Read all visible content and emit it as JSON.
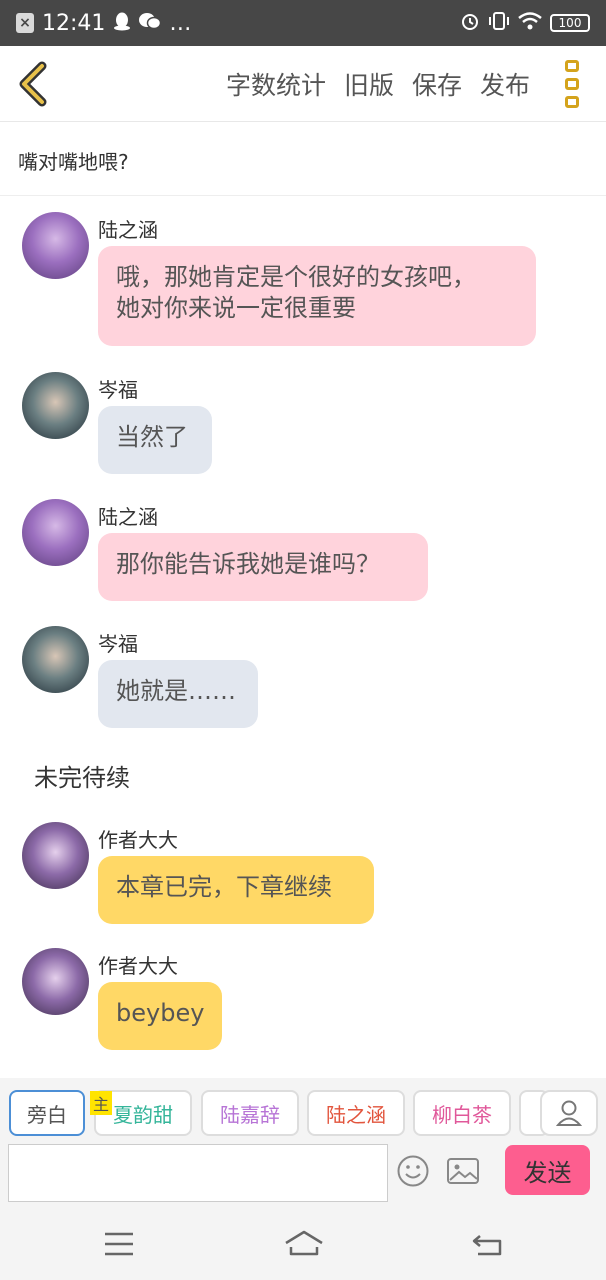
{
  "status_bar": {
    "time": "12:41",
    "dots": "…",
    "battery": "100",
    "icons": [
      "close-box-icon",
      "qq-icon",
      "wechat-icon",
      "alarm-icon",
      "vibrate-icon",
      "wifi-icon",
      "battery-icon"
    ]
  },
  "toolbar": {
    "word_count_label": "字数统计",
    "old_version_label": "旧版",
    "save_label": "保存",
    "publish_label": "发布",
    "accent": "#d4a31c"
  },
  "chapter_title": "嘴对嘴地喂?",
  "messages": [
    {
      "sender": "陆之涵",
      "line1": "哦，那她肯定是个很好的女孩吧，",
      "line2": "她对你来说一定很重要",
      "color": "#ffd3dc"
    },
    {
      "sender": "岑福",
      "text": "当然了",
      "color": "#e2e7ef"
    },
    {
      "sender": "陆之涵",
      "text": "那你能告诉我她是谁吗？",
      "color": "#ffd3dc"
    },
    {
      "sender": "岑福",
      "text": "她就是……",
      "color": "#e2e7ef"
    },
    {
      "narration": "未完待续"
    },
    {
      "sender": "作者大大",
      "text": "本章已完，下章继续",
      "color": "#ffd866"
    },
    {
      "sender": "作者大大",
      "text": "beybey",
      "color": "#ffd866"
    }
  ],
  "roles": {
    "narrator": "旁白",
    "host_tag": "主",
    "list": [
      {
        "label": "夏韵甜",
        "color": "#35b59a"
      },
      {
        "label": "陆嘉辞",
        "color": "#b774d6"
      },
      {
        "label": "陆之涵",
        "color": "#e2553d"
      },
      {
        "label": "柳白茶",
        "color": "#e0589a"
      }
    ]
  },
  "input": {
    "send_label": "发送",
    "send_color": "#fd5e8f"
  }
}
